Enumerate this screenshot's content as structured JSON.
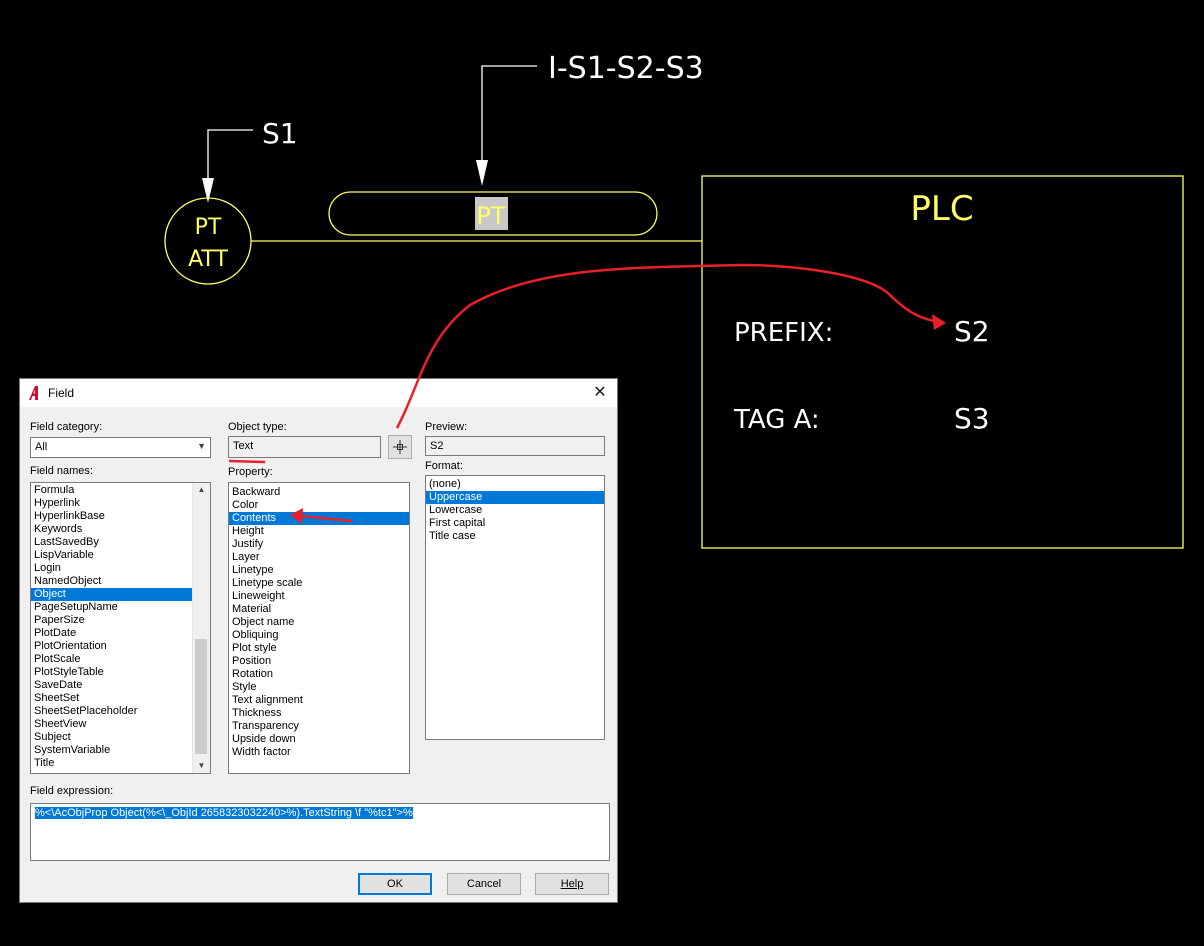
{
  "drawing": {
    "leader_top_text": "I-S1-S2-S3",
    "leader_left_text": "S1",
    "circle_line1": "PT",
    "circle_line2": "ATT",
    "pill_text": "PT",
    "plc_title": "PLC",
    "prefix_label": "PREFIX:",
    "prefix_value": "S2",
    "tag_label": "TAG  A:",
    "tag_value": "S3",
    "line_color": "#ffff66",
    "annotation_color": "#e8202a"
  },
  "dialog": {
    "title": "Field",
    "close_glyph": "✕",
    "field_category_label": "Field category:",
    "field_category_value": "All",
    "field_names_label": "Field names:",
    "field_names": [
      "Formula",
      "Hyperlink",
      "HyperlinkBase",
      "Keywords",
      "LastSavedBy",
      "LispVariable",
      "Login",
      "NamedObject",
      "Object",
      "PageSetupName",
      "PaperSize",
      "PlotDate",
      "PlotOrientation",
      "PlotScale",
      "PlotStyleTable",
      "SaveDate",
      "SheetSet",
      "SheetSetPlaceholder",
      "SheetView",
      "Subject",
      "SystemVariable",
      "Title"
    ],
    "field_names_selected": "Object",
    "object_type_label": "Object type:",
    "object_type_value": "Text",
    "property_label": "Property:",
    "properties": [
      "Backward",
      "Color",
      "Contents",
      "Height",
      "Justify",
      "Layer",
      "Linetype",
      "Linetype scale",
      "Lineweight",
      "Material",
      "Object name",
      "Obliquing",
      "Plot style",
      "Position",
      "Rotation",
      "Style",
      "Text alignment",
      "Thickness",
      "Transparency",
      "Upside down",
      "Width factor"
    ],
    "property_selected": "Contents",
    "preview_label": "Preview:",
    "preview_value": "S2",
    "format_label": "Format:",
    "formats": [
      "(none)",
      "Uppercase",
      "Lowercase",
      "First capital",
      "Title case"
    ],
    "format_selected": "Uppercase",
    "field_expression_label": "Field expression:",
    "field_expression": "%<\\AcObjProp Object(%<\\_ObjId 2658323032240>%).TextString \\f \"%tc1\">%",
    "ok_label": "OK",
    "cancel_label": "Cancel",
    "help_label": "Help"
  }
}
